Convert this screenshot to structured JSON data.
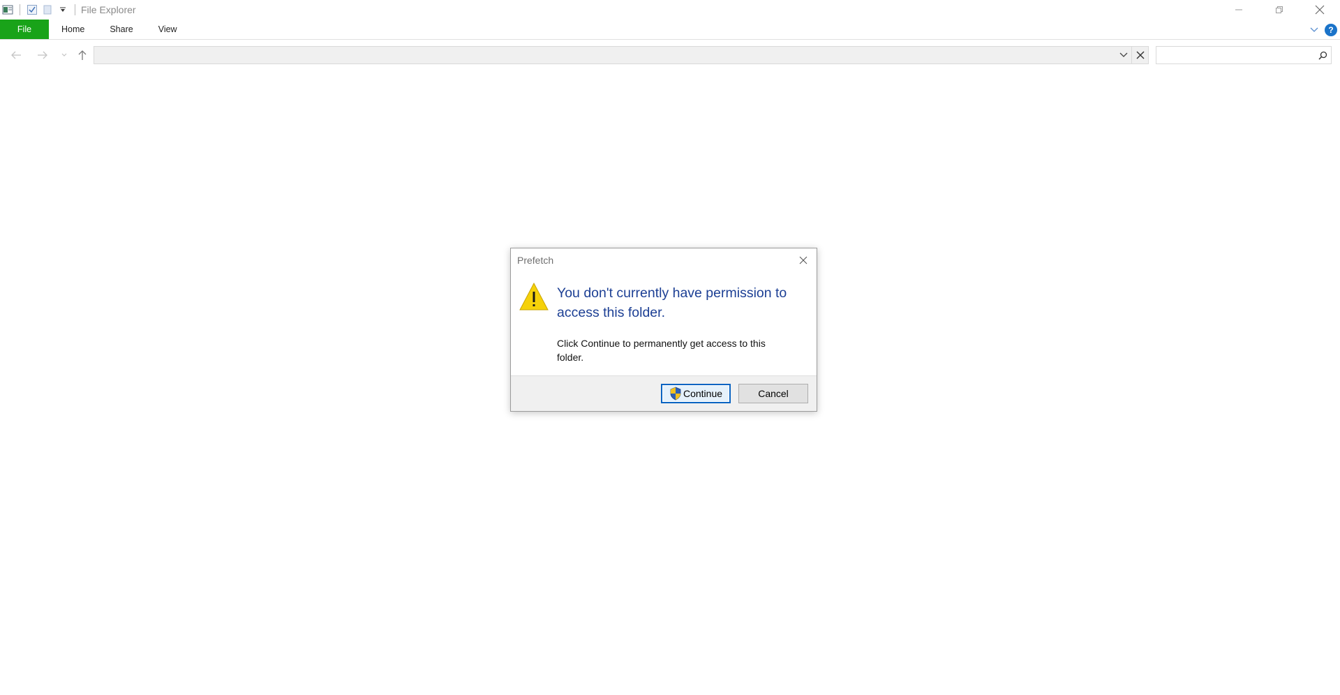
{
  "window": {
    "title": "File Explorer"
  },
  "ribbon": {
    "tabs": [
      {
        "label": "File"
      },
      {
        "label": "Home"
      },
      {
        "label": "Share"
      },
      {
        "label": "View"
      }
    ],
    "file_tab_color": "#19a319",
    "help_label": "?"
  },
  "navigation": {
    "address_value": "",
    "search_placeholder": ""
  },
  "dialog": {
    "title": "Prefetch",
    "heading": "You don't currently have permission to access this folder.",
    "body": "Click Continue to permanently get access to this folder.",
    "continue_label": "Continue",
    "cancel_label": "Cancel",
    "heading_color": "#1c3f94"
  },
  "icons": {
    "quick_access": [
      "properties-icon",
      "checkmark-icon",
      "new-folder-icon",
      "customize-dropdown-icon"
    ],
    "nav": [
      "back-arrow-icon",
      "forward-arrow-icon",
      "recent-locations-icon",
      "up-arrow-icon"
    ],
    "dialog": [
      "warning-icon",
      "uac-shield-icon",
      "close-icon"
    ]
  }
}
